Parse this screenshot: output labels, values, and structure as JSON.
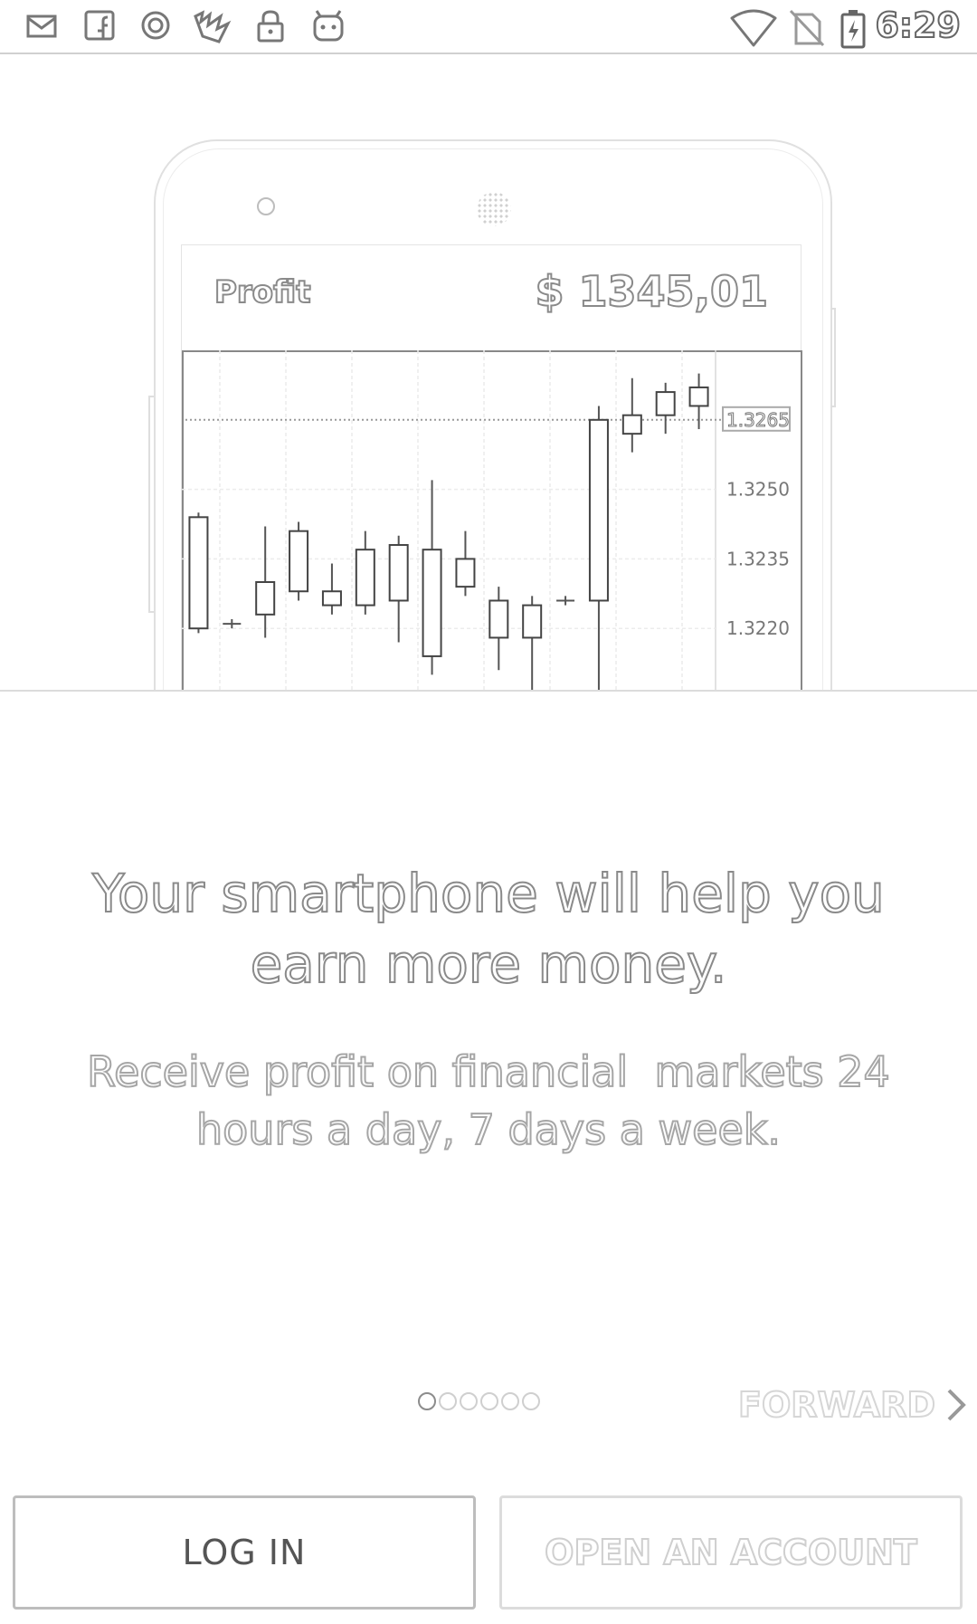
{
  "status_bar": {
    "time": "6:29",
    "left_icons": [
      "mail-icon",
      "facebook-icon",
      "circle-app-icon",
      "fire-app-icon",
      "lock-icon",
      "robot-app-icon"
    ],
    "right_icons": [
      "wifi-icon",
      "no-sim-icon",
      "battery-charging-icon"
    ]
  },
  "hero": {
    "profit_label": "Profit",
    "profit_value": "$ 1345,01"
  },
  "chart_data": {
    "type": "candlestick",
    "y_ticks": [
      "1.3250",
      "1.3235",
      "1.3220"
    ],
    "current_price": "1.3265",
    "ylim": [
      1.3205,
      1.328
    ],
    "candles": [
      {
        "o": 1.322,
        "h": 1.3245,
        "l": 1.3219,
        "c": 1.3244
      },
      {
        "o": 1.3221,
        "h": 1.3222,
        "l": 1.322,
        "c": 1.3221
      },
      {
        "o": 1.323,
        "h": 1.3242,
        "l": 1.3218,
        "c": 1.3223
      },
      {
        "o": 1.3228,
        "h": 1.3243,
        "l": 1.3226,
        "c": 1.3241
      },
      {
        "o": 1.3225,
        "h": 1.3234,
        "l": 1.3223,
        "c": 1.3228
      },
      {
        "o": 1.3237,
        "h": 1.3241,
        "l": 1.3223,
        "c": 1.3225
      },
      {
        "o": 1.3238,
        "h": 1.324,
        "l": 1.3217,
        "c": 1.3226
      },
      {
        "o": 1.3237,
        "h": 1.3252,
        "l": 1.321,
        "c": 1.3214
      },
      {
        "o": 1.3235,
        "h": 1.3241,
        "l": 1.3227,
        "c": 1.3229
      },
      {
        "o": 1.3226,
        "h": 1.3229,
        "l": 1.3211,
        "c": 1.3218
      },
      {
        "o": 1.3225,
        "h": 1.3227,
        "l": 1.3205,
        "c": 1.3218
      },
      {
        "o": 1.3226,
        "h": 1.3227,
        "l": 1.3225,
        "c": 1.3226
      },
      {
        "o": 1.3226,
        "h": 1.3268,
        "l": 1.3205,
        "c": 1.3265
      },
      {
        "o": 1.3262,
        "h": 1.3274,
        "l": 1.3258,
        "c": 1.3266
      },
      {
        "o": 1.3266,
        "h": 1.3273,
        "l": 1.3262,
        "c": 1.3271
      },
      {
        "o": 1.3268,
        "h": 1.3275,
        "l": 1.3263,
        "c": 1.3272
      }
    ]
  },
  "headline": {
    "line1": "Your smartphone will help you",
    "line2": "earn more money."
  },
  "subheadline": {
    "line1": "Receive profit on financial  markets 24",
    "line2": "hours a day, 7 days a week."
  },
  "pager": {
    "total": 6,
    "active": 0,
    "forward_label": "FORWARD"
  },
  "buttons": {
    "login": "LOG IN",
    "open_account": "OPEN AN ACCOUNT"
  }
}
